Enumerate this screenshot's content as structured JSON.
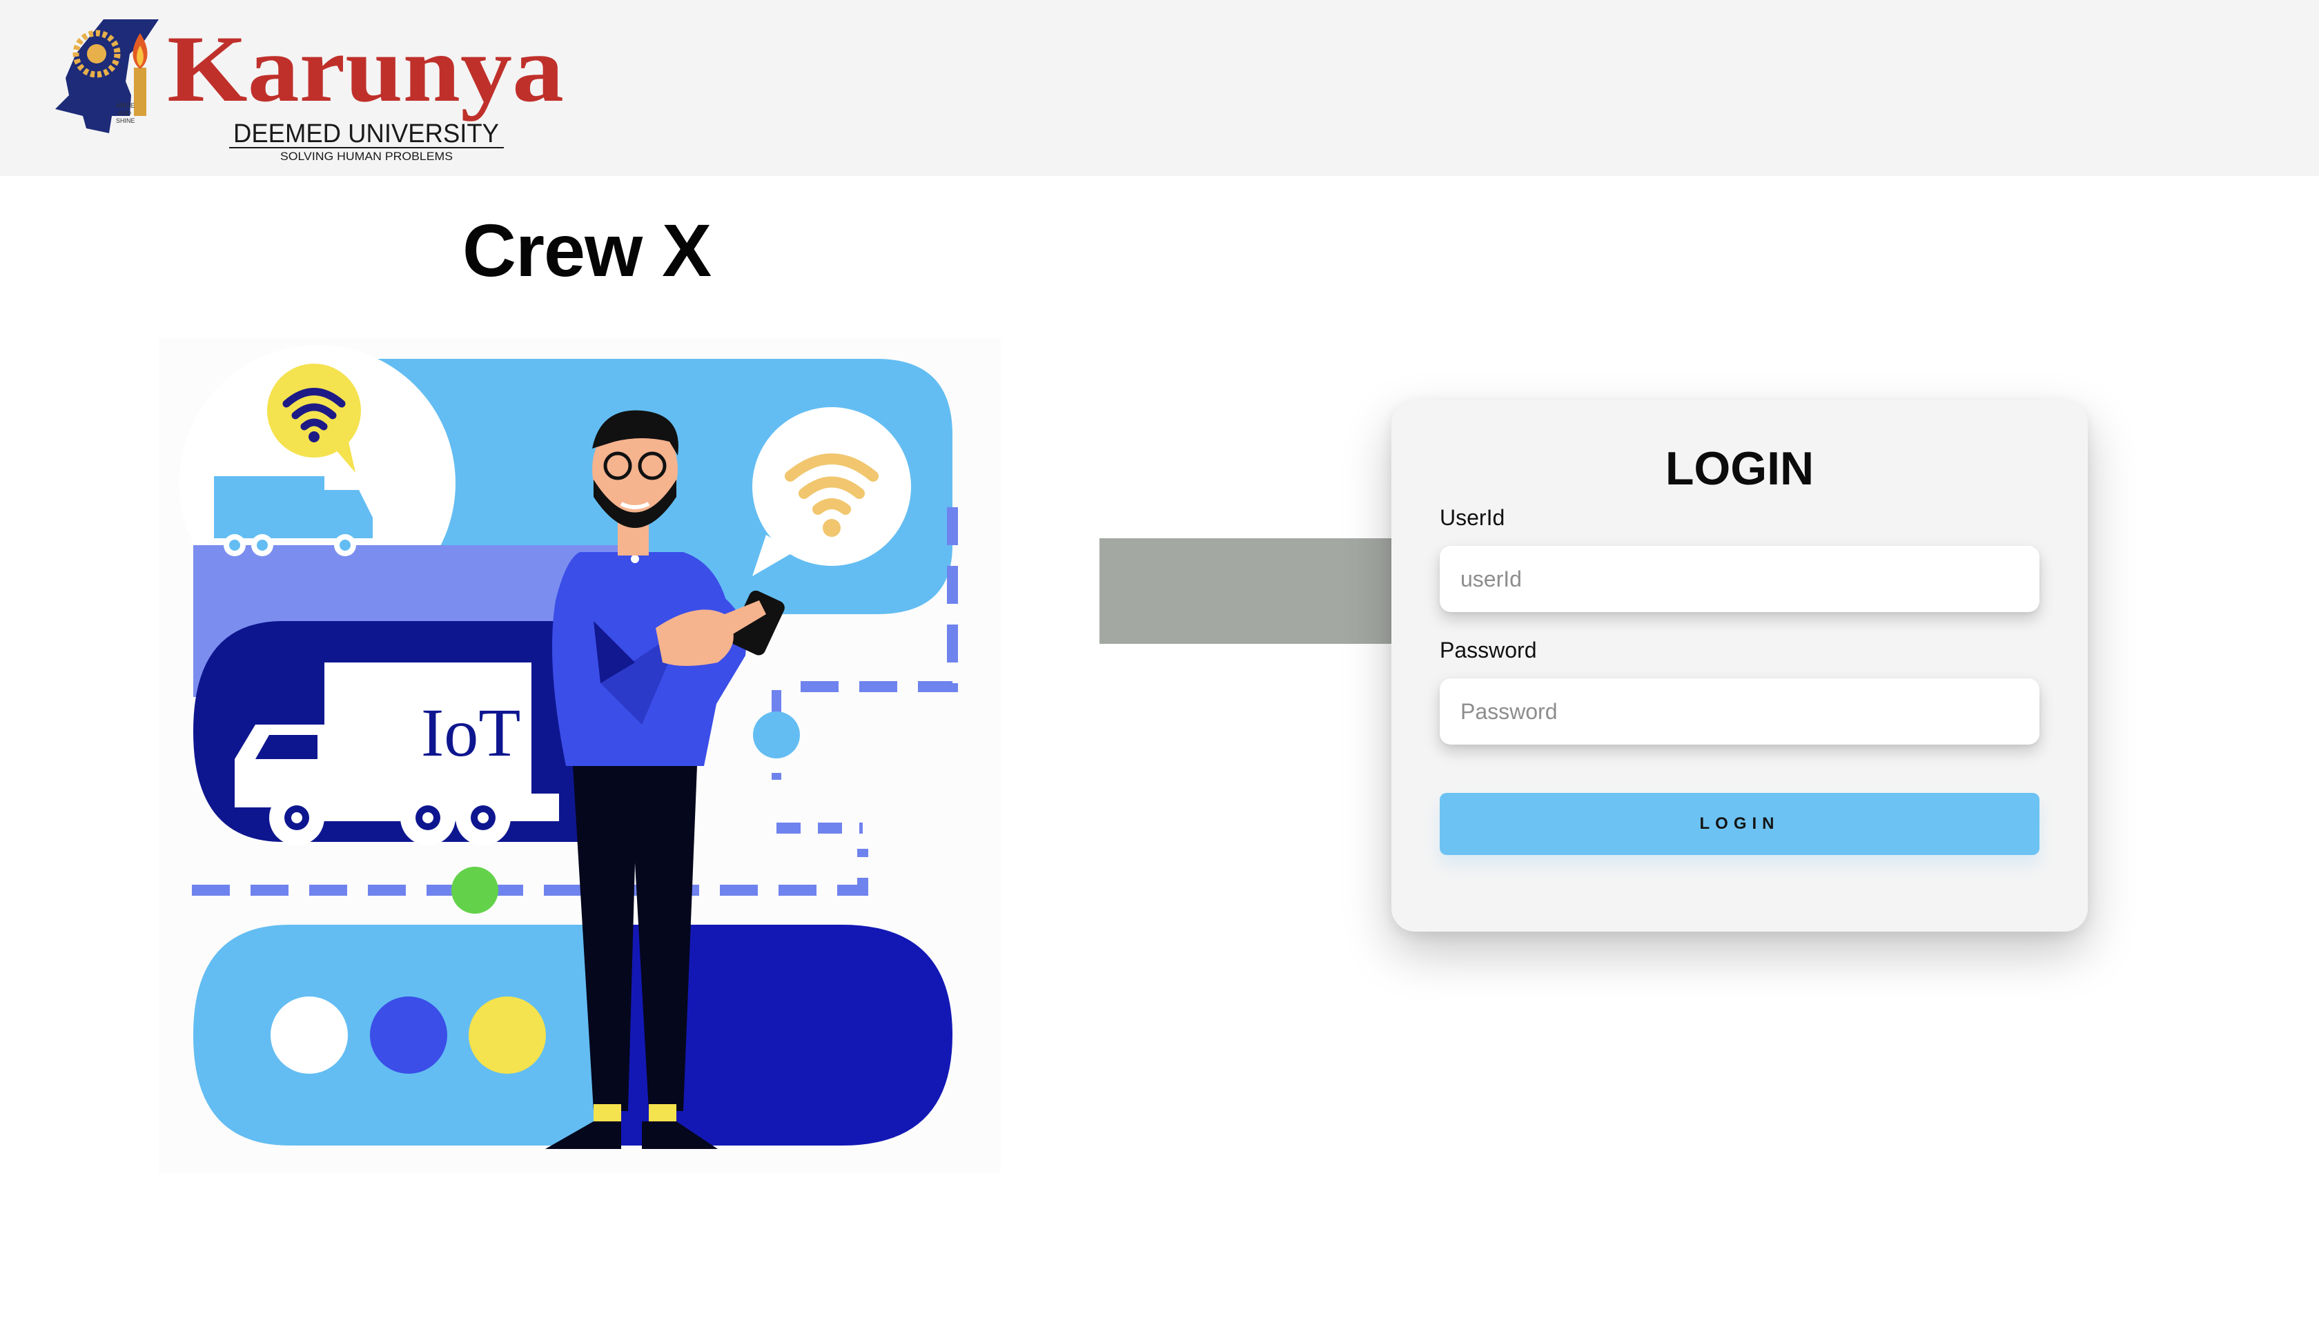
{
  "header": {
    "logo": {
      "name": "Karunya",
      "subtitle": "DEEMED UNIVERSITY",
      "tagline": "SOLVING HUMAN PROBLEMS",
      "emblem_text": [
        "ARISE",
        "AND",
        "SHINE"
      ],
      "name_color": "#c0302b"
    }
  },
  "main": {
    "title": "Crew X",
    "illustration": {
      "icon": "iot-delivery-illustration",
      "truck_label": "IoT",
      "colors": [
        "#63bdf2",
        "#7b8ef0",
        "#0e168f",
        "#3b4ee8",
        "#f4e24e",
        "#63d24a"
      ]
    }
  },
  "login": {
    "heading": "LOGIN",
    "userid_label": "UserId",
    "userid_placeholder": "userId",
    "password_label": "Password",
    "password_placeholder": "Password",
    "button_label": "LOGIN",
    "button_color": "#6cc3f3"
  },
  "redacted_color": "#a4a8a3"
}
